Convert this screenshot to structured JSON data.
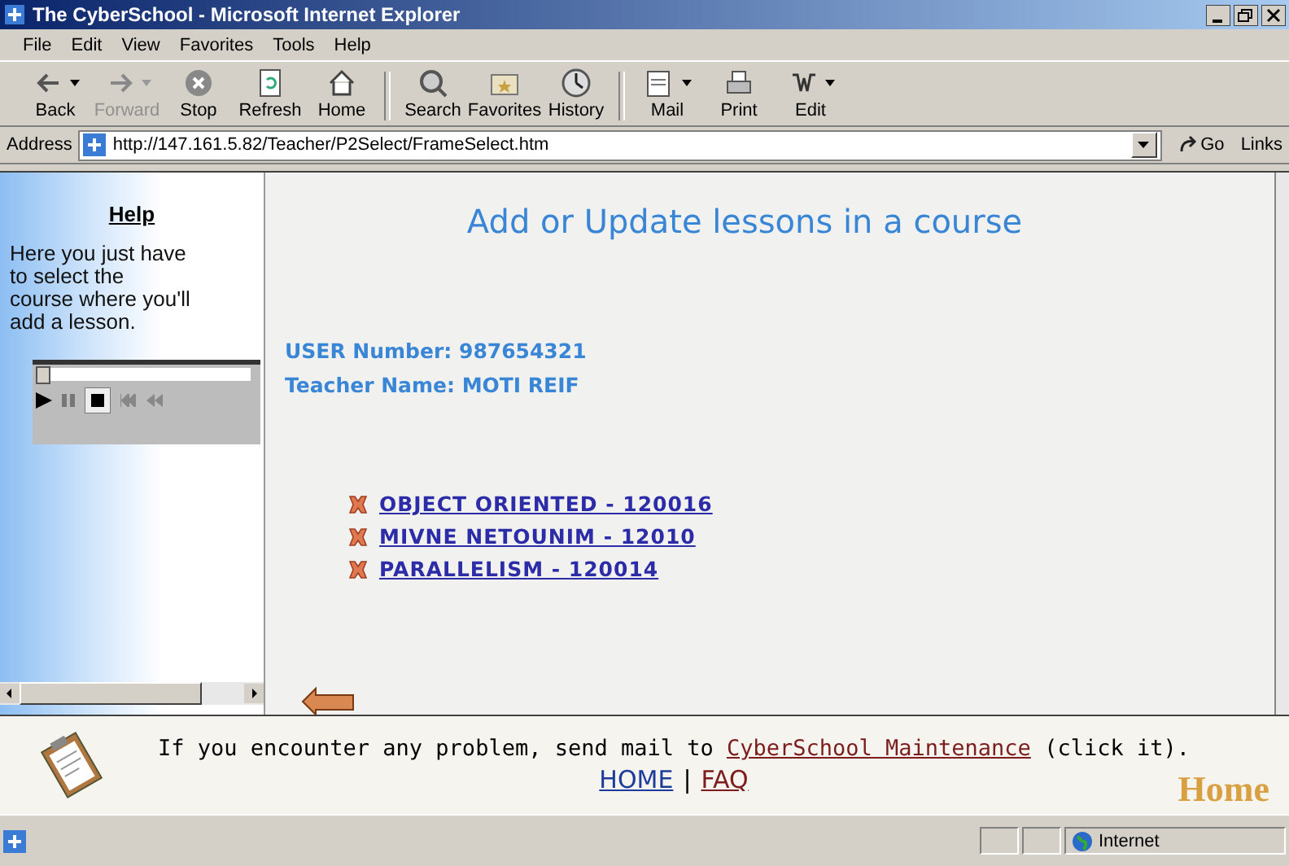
{
  "window": {
    "title": "The CyberSchool - Microsoft Internet Explorer"
  },
  "menu": [
    "File",
    "Edit",
    "View",
    "Favorites",
    "Tools",
    "Help"
  ],
  "toolbar": [
    {
      "label": "Back",
      "disabled": false,
      "dropdown": true
    },
    {
      "label": "Forward",
      "disabled": true,
      "dropdown": true
    },
    {
      "label": "Stop",
      "disabled": false,
      "dropdown": false
    },
    {
      "label": "Refresh",
      "disabled": false,
      "dropdown": false
    },
    {
      "label": "Home",
      "disabled": false,
      "dropdown": false
    },
    {
      "label": "Search",
      "disabled": false,
      "dropdown": false
    },
    {
      "label": "Favorites",
      "disabled": false,
      "dropdown": false
    },
    {
      "label": "History",
      "disabled": false,
      "dropdown": false
    },
    {
      "label": "Mail",
      "disabled": false,
      "dropdown": true
    },
    {
      "label": "Print",
      "disabled": false,
      "dropdown": false
    },
    {
      "label": "Edit",
      "disabled": false,
      "dropdown": true
    }
  ],
  "address": {
    "label": "Address",
    "value": "http://147.161.5.82/Teacher/P2Select/FrameSelect.htm",
    "go": "Go",
    "links": "Links"
  },
  "help_frame": {
    "heading": "Help",
    "text": "Here you just have to select the course where you'll add a lesson.",
    "player": {
      "level": 0
    }
  },
  "main_frame": {
    "heading": "Add or Update lessons in a course",
    "user_number": "USER Number: 987654321",
    "teacher_name": "Teacher Name: MOTI REIF",
    "courses": [
      "OBJECT ORIENTED - 120016",
      "MIVNE NETOUNIM - 12010",
      "PARALLELISM - 120014"
    ]
  },
  "footer": {
    "message_before": "If you encounter any problem, send mail to ",
    "message_link": "CyberSchool Maintenance",
    "message_after": " (click it).",
    "links": [
      {
        "label": "HOME",
        "color": "#1c3c9c"
      },
      {
        "label": "FAQ",
        "color": "#7c1c1c"
      }
    ],
    "separator": "|",
    "logo": "Home"
  },
  "status_bar": {
    "zone": "Internet"
  }
}
